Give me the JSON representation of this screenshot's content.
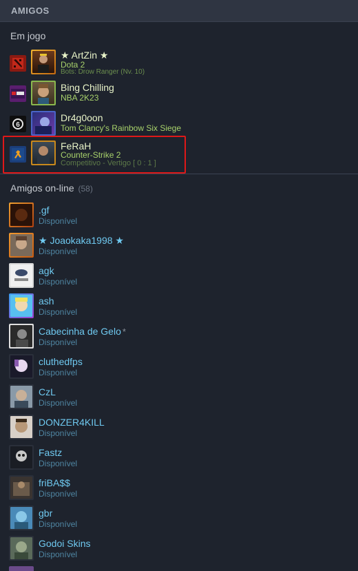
{
  "header": {
    "title": "AMIGOS"
  },
  "in_game": {
    "title": "Em jogo",
    "friends": [
      {
        "name": "★ ArtZin ★",
        "game": "Dota 2",
        "status": "Bots: Drow Ranger (Nv. 10)",
        "game_icon": "dota2-icon"
      },
      {
        "name": "Bing Chilling",
        "game": "NBA 2K23",
        "status": "",
        "game_icon": "nba2k23-icon"
      },
      {
        "name": "Dr4g0oon",
        "game": "Tom Clancy's Rainbow Six Siege",
        "status": "",
        "game_icon": "rainbow-six-icon"
      },
      {
        "name": "FeRaH",
        "game": "Counter-Strike 2",
        "status": "Competitivo - Vertigo [ 0 : 1 ]",
        "game_icon": "cs2-icon"
      }
    ]
  },
  "online": {
    "title": "Amigos on-line",
    "count": "(58)",
    "friends": [
      {
        "name": ".gf",
        "status": "Disponível"
      },
      {
        "name": "★ Joaokaka1998 ★",
        "status": "Disponível"
      },
      {
        "name": "agk",
        "status": "Disponível"
      },
      {
        "name": "ash",
        "status": "Disponível"
      },
      {
        "name": "Cabecinha de Gelo",
        "nickname_mark": "*",
        "status": "Disponível"
      },
      {
        "name": "cluthedfps",
        "status": "Disponível"
      },
      {
        "name": "CzL",
        "status": "Disponível"
      },
      {
        "name": "DONZER4KILL",
        "status": "Disponível"
      },
      {
        "name": "Fastz",
        "status": "Disponível"
      },
      {
        "name": "friBA$$",
        "status": "Disponível"
      },
      {
        "name": "gbr",
        "status": "Disponível"
      },
      {
        "name": "Godoi Skins",
        "status": "Disponível"
      }
    ]
  },
  "colors": {
    "background": "#1e232d",
    "header": "#2f3542",
    "in_game_name": "#e8f3c8",
    "in_game_game": "#a8d26b",
    "online_name": "#6fc9f0",
    "online_status": "#4f86a3",
    "selection": "#e01818"
  }
}
